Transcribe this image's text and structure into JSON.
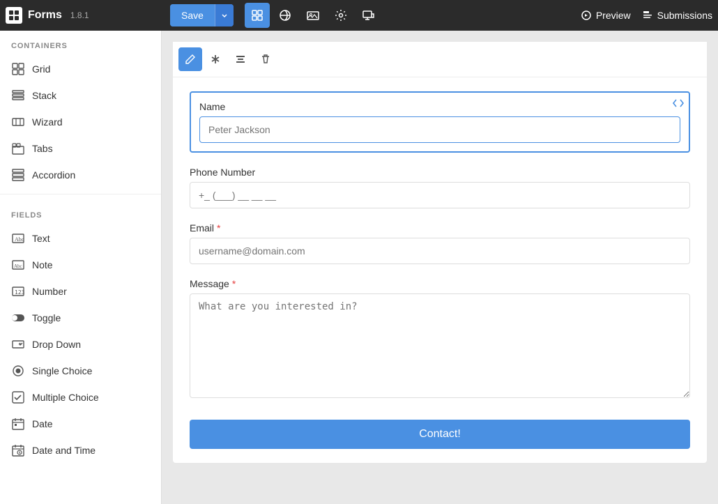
{
  "topbar": {
    "app_name": "Forms",
    "version": "1.8.1",
    "save_label": "Save",
    "preview_label": "Preview",
    "submissions_label": "Submissions"
  },
  "sidebar": {
    "containers_title": "CONTAINERS",
    "containers": [
      {
        "id": "grid",
        "label": "Grid"
      },
      {
        "id": "stack",
        "label": "Stack"
      },
      {
        "id": "wizard",
        "label": "Wizard"
      },
      {
        "id": "tabs",
        "label": "Tabs"
      },
      {
        "id": "accordion",
        "label": "Accordion"
      }
    ],
    "fields_title": "FIELDS",
    "fields": [
      {
        "id": "text",
        "label": "Text"
      },
      {
        "id": "note",
        "label": "Note"
      },
      {
        "id": "number",
        "label": "Number"
      },
      {
        "id": "toggle",
        "label": "Toggle"
      },
      {
        "id": "dropdown",
        "label": "Drop Down"
      },
      {
        "id": "single-choice",
        "label": "Single Choice"
      },
      {
        "id": "multiple-choice",
        "label": "Multiple Choice"
      },
      {
        "id": "date",
        "label": "Date"
      },
      {
        "id": "date-time",
        "label": "Date and Time"
      }
    ]
  },
  "form": {
    "name_label": "Name",
    "name_placeholder": "Peter Jackson",
    "phone_label": "Phone Number",
    "phone_placeholder": "+_ (___) __ __ __",
    "email_label": "Email",
    "email_required": true,
    "email_placeholder": "username@domain.com",
    "message_label": "Message",
    "message_required": true,
    "message_placeholder": "What are you interested in?",
    "submit_label": "Contact!"
  }
}
